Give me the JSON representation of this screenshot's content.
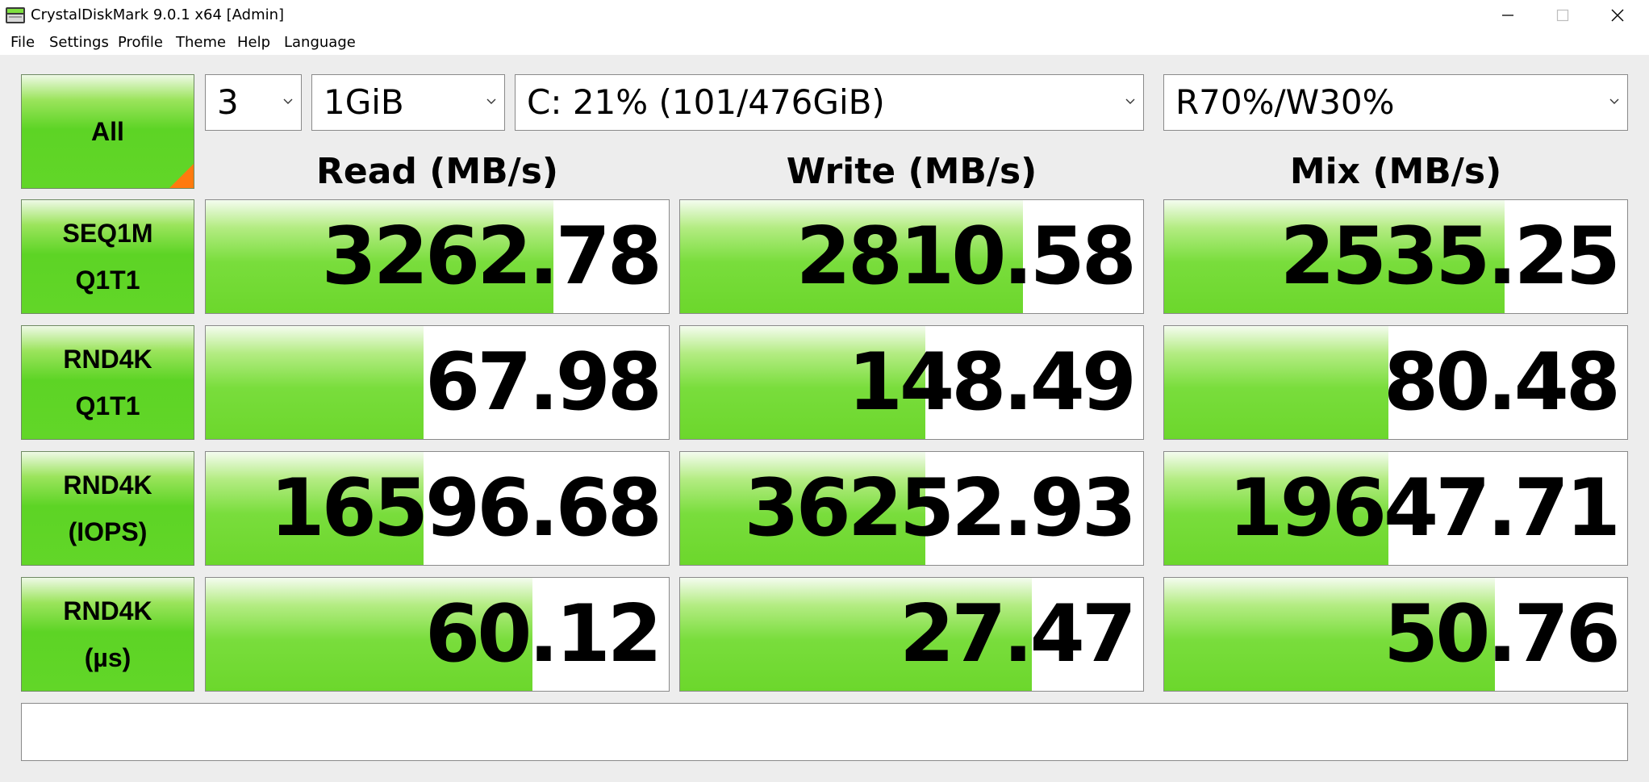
{
  "window": {
    "title": "CrystalDiskMark 9.0.1 x64 [Admin]",
    "icons": {
      "app": "disk-icon",
      "minimize": "minimize-icon",
      "maximize": "maximize-icon",
      "close": "close-icon"
    }
  },
  "menu": {
    "items": [
      "File",
      "Settings",
      "Profile",
      "Theme",
      "Help",
      "Language"
    ]
  },
  "controls": {
    "all_label": "All",
    "count": "3",
    "size": "1GiB",
    "drive": "C: 21% (101/476GiB)",
    "mix": "R70%/W30%"
  },
  "headers": {
    "read": "Read (MB/s)",
    "write": "Write (MB/s)",
    "mix": "Mix (MB/s)"
  },
  "rows": [
    {
      "line1": "SEQ1M",
      "line2": "Q1T1",
      "read": {
        "value": "3262.78",
        "fill": 0.75
      },
      "write": {
        "value": "2810.58",
        "fill": 0.74
      },
      "mix": {
        "value": "2535.25",
        "fill": 0.735
      }
    },
    {
      "line1": "RND4K",
      "line2": "Q1T1",
      "read": {
        "value": "67.98",
        "fill": 0.47
      },
      "write": {
        "value": "148.49",
        "fill": 0.53
      },
      "mix": {
        "value": "80.48",
        "fill": 0.485
      }
    },
    {
      "line1": "RND4K",
      "line2": "(IOPS)",
      "read": {
        "value": "16596.68",
        "fill": 0.47
      },
      "write": {
        "value": "36252.93",
        "fill": 0.53
      },
      "mix": {
        "value": "19647.71",
        "fill": 0.485
      }
    },
    {
      "line1": "RND4K",
      "line2": "(µs)",
      "read": {
        "value": "60.12",
        "fill": 0.705
      },
      "write": {
        "value": "27.47",
        "fill": 0.76
      },
      "mix": {
        "value": "50.76",
        "fill": 0.715
      }
    }
  ],
  "colors": {
    "bar_green": "#6cd72c",
    "corner_orange": "#ff7a0e",
    "background": "#ededed"
  },
  "comment": ""
}
